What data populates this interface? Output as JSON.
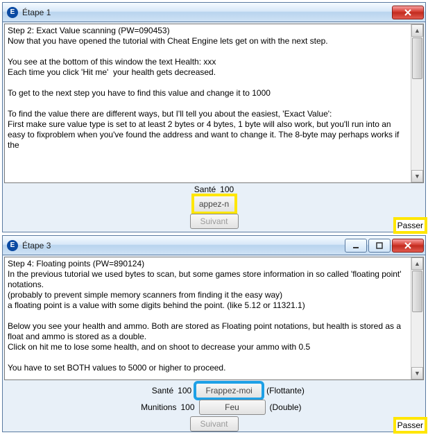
{
  "win1": {
    "title": "Étape 1",
    "text": "Step 2: Exact Value scanning (PW=090453)\nNow that you have opened the tutorial with Cheat Engine lets get on with the next step.\n\nYou see at the bottom of this window the text Health: xxx\nEach time you click 'Hit me'  your health gets decreased.\n\nTo get to the next step you have to find this value and change it to 1000\n\nTo find the value there are different ways, but I'll tell you about the easiest, 'Exact Value':\nFirst make sure value type is set to at least 2 bytes or 4 bytes, 1 byte will also work, but you'll run into an easy to fixproblem when you've found the address and want to change it. The 8-byte may perhaps works if the",
    "health_label": "Santé",
    "health_value": "100",
    "hit_button": "appez-n",
    "next_button": "Suivant",
    "skip_label": "Passer"
  },
  "win2": {
    "title": "Étape 3",
    "text": "Step 4: Floating points (PW=890124)\nIn the previous tutorial we used bytes to scan, but some games store information in so called 'floating point' notations.\n(probably to prevent simple memory scanners from finding it the easy way)\na floating point is a value with some digits behind the point. (like 5.12 or 11321.1)\n\nBelow you see your health and ammo. Both are stored as Floating point notations, but health is stored as a float and ammo is stored as a double.\nClick on hit me to lose some health, and on shoot to decrease your ammo with 0.5\n\nYou have to set BOTH values to 5000 or higher to proceed.",
    "health_label": "Santé",
    "health_value": "100",
    "health_suffix": "(Flottante)",
    "hit_button": "Frappez-moi",
    "ammo_label": "Munitions",
    "ammo_value": "100",
    "ammo_suffix": "(Double)",
    "fire_button": "Feu",
    "next_button": "Suivant",
    "skip_label": "Passer"
  }
}
